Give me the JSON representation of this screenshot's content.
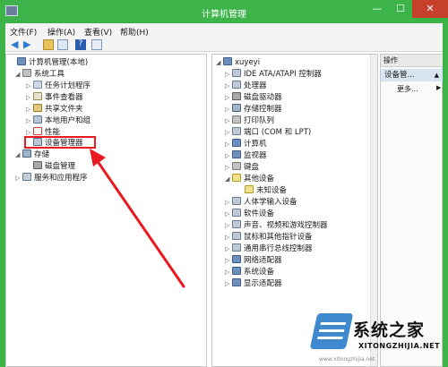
{
  "window": {
    "title": "计算机管理",
    "minimize": "—",
    "maximize": "☐",
    "close": "✕"
  },
  "menu": {
    "file": "文件(F)",
    "action": "操作(A)",
    "view": "查看(V)",
    "help": "帮助(H)"
  },
  "toolbar": {
    "help_glyph": "?"
  },
  "left_tree": [
    {
      "label": "计算机管理(本地)",
      "icon": "computer-icon",
      "expander": ""
    },
    {
      "label": "系统工具",
      "icon": "tools-icon",
      "expander": "◢"
    },
    {
      "label": "任务计划程序",
      "icon": "task-scheduler-icon",
      "expander": "▷"
    },
    {
      "label": "事件查看器",
      "icon": "event-viewer-icon",
      "expander": "▷"
    },
    {
      "label": "共享文件夹",
      "icon": "shared-folder-icon",
      "expander": "▷"
    },
    {
      "label": "本地用户和组",
      "icon": "users-icon",
      "expander": "▷"
    },
    {
      "label": "性能",
      "icon": "performance-icon",
      "expander": "▷"
    },
    {
      "label": "设备管理器",
      "icon": "device-manager-icon",
      "expander": ""
    },
    {
      "label": "存储",
      "icon": "storage-icon",
      "expander": "◢"
    },
    {
      "label": "磁盘管理",
      "icon": "disk-icon",
      "expander": ""
    },
    {
      "label": "服务和应用程序",
      "icon": "services-icon",
      "expander": "▷"
    }
  ],
  "device_tree": [
    {
      "label": "xuyeyi",
      "icon": "computer-icon",
      "expander": "◢"
    },
    {
      "label": "IDE ATA/ATAPI 控制器",
      "icon": "ide-icon",
      "expander": "▷"
    },
    {
      "label": "处理器",
      "icon": "processor-icon",
      "expander": "▷"
    },
    {
      "label": "磁盘驱动器",
      "icon": "disk-drive-icon",
      "expander": "▷"
    },
    {
      "label": "存储控制器",
      "icon": "storage-controller-icon",
      "expander": "▷"
    },
    {
      "label": "打印队列",
      "icon": "printer-icon",
      "expander": "▷"
    },
    {
      "label": "端口 (COM 和 LPT)",
      "icon": "port-icon",
      "expander": "▷"
    },
    {
      "label": "计算机",
      "icon": "computer-icon",
      "expander": "▷"
    },
    {
      "label": "监视器",
      "icon": "monitor-icon",
      "expander": "▷"
    },
    {
      "label": "键盘",
      "icon": "keyboard-icon",
      "expander": "▷"
    },
    {
      "label": "其他设备",
      "icon": "other-device-icon",
      "expander": "◢"
    },
    {
      "label": "未知设备",
      "icon": "unknown-device-icon",
      "expander": ""
    },
    {
      "label": "人体学输入设备",
      "icon": "hid-icon",
      "expander": "▷"
    },
    {
      "label": "软件设备",
      "icon": "software-device-icon",
      "expander": "▷"
    },
    {
      "label": "声音、视频和游戏控制器",
      "icon": "sound-icon",
      "expander": "▷"
    },
    {
      "label": "鼠标和其他指针设备",
      "icon": "mouse-icon",
      "expander": "▷"
    },
    {
      "label": "通用串行总线控制器",
      "icon": "usb-icon",
      "expander": "▷"
    },
    {
      "label": "网络适配器",
      "icon": "network-icon",
      "expander": "▷"
    },
    {
      "label": "系统设备",
      "icon": "system-device-icon",
      "expander": "▷"
    },
    {
      "label": "显示适配器",
      "icon": "display-adapter-icon",
      "expander": "▷"
    }
  ],
  "actions": {
    "header": "操作",
    "group": "设备管...",
    "group_arrow": "▲",
    "more": "更多...",
    "more_arrow": "▶"
  },
  "watermark": {
    "title": "系统之家",
    "url": "XITONGZHIJIA.NET",
    "small": "www.xitongzhijia.net"
  },
  "colors": {
    "titlebar": "#3db44a",
    "close": "#c7402c",
    "highlight": "#e8191f",
    "action_group": "#d8e4f1"
  }
}
